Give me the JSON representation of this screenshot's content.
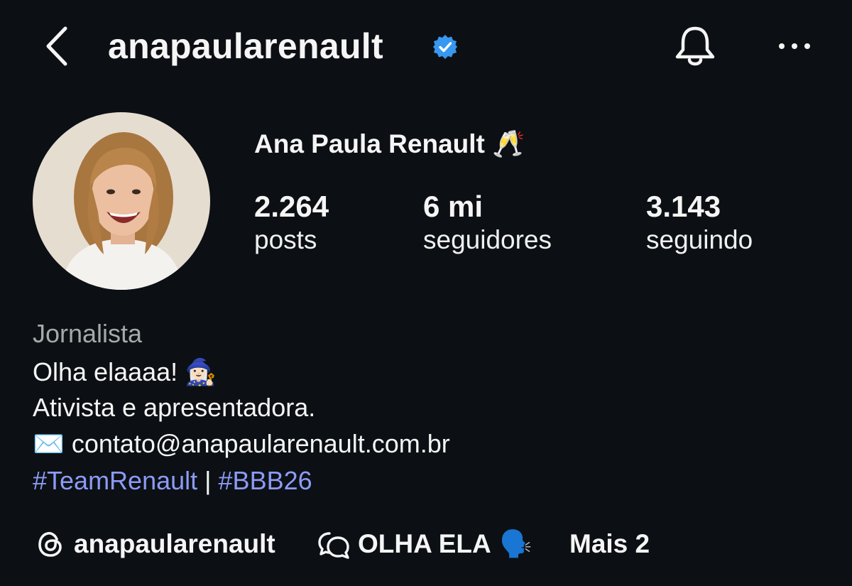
{
  "header": {
    "username": "anapaularenault",
    "icons": {
      "back": "chevron-left-icon",
      "verified": "verified-badge-icon",
      "notifications": "bell-icon",
      "more": "more-horizontal-icon"
    },
    "accent_color": "#3897f0"
  },
  "profile": {
    "display_name": "Ana Paula Renault",
    "name_emoji": "🥂",
    "stats": [
      {
        "value": "2.264",
        "label": "posts"
      },
      {
        "value": "6 mi",
        "label": "seguidores"
      },
      {
        "value": "3.143",
        "label": "seguindo"
      }
    ]
  },
  "bio": {
    "category": "Jornalista",
    "line1": "Olha elaaaa!",
    "line1_emoji": "🧙🏻‍♀️",
    "line2": "Ativista e apresentadora.",
    "email_emoji": "✉️",
    "email": "contato@anapaularenault.com.br",
    "hashtag1": "#TeamRenault",
    "separator": "|",
    "hashtag2": "#BBB26",
    "hashtag_color": "#8c9bf5"
  },
  "links": {
    "threads_handle": "anapaularenault",
    "channel_name": "OLHA ELA",
    "channel_emoji": "🗣️",
    "more_label": "Mais 2"
  }
}
